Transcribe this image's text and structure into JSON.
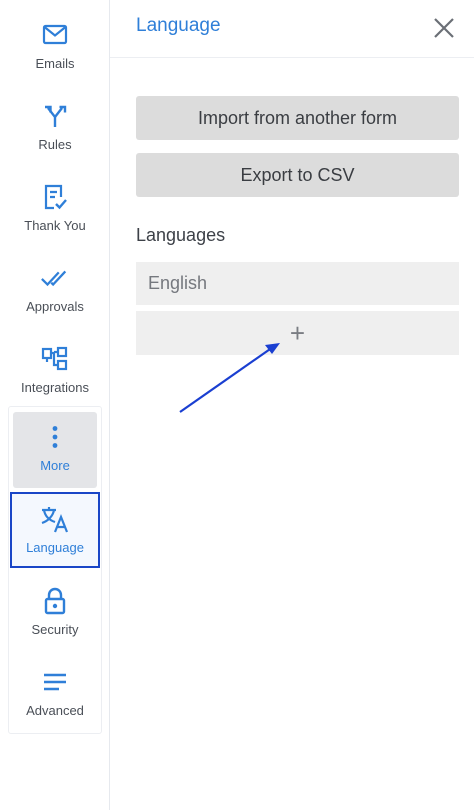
{
  "sidebar": {
    "items": [
      {
        "id": "emails",
        "label": "Emails",
        "icon": "envelope-icon"
      },
      {
        "id": "rules",
        "label": "Rules",
        "icon": "fork-arrows-icon"
      },
      {
        "id": "thank-you",
        "label": "Thank You",
        "icon": "document-check-icon"
      },
      {
        "id": "approvals",
        "label": "Approvals",
        "icon": "double-check-icon"
      },
      {
        "id": "integrations",
        "label": "Integrations",
        "icon": "integration-blocks-icon"
      },
      {
        "id": "more",
        "label": "More",
        "icon": "vertical-dots-icon"
      },
      {
        "id": "language",
        "label": "Language",
        "icon": "translate-icon"
      },
      {
        "id": "security",
        "label": "Security",
        "icon": "lock-icon"
      },
      {
        "id": "advanced",
        "label": "Advanced",
        "icon": "menu-lines-icon"
      }
    ],
    "active": "language"
  },
  "header": {
    "title": "Language",
    "close_icon": "close-icon"
  },
  "panel": {
    "import_label": "Import from another form",
    "export_label": "Export to CSV",
    "languages_heading": "Languages",
    "languages": [
      "English"
    ],
    "add_symbol": "+"
  },
  "colors": {
    "accent": "#2f7fd8",
    "active_border": "#1a46c7",
    "button_bg": "#dcdcdc",
    "annotation_arrow": "#1a3fd1"
  }
}
